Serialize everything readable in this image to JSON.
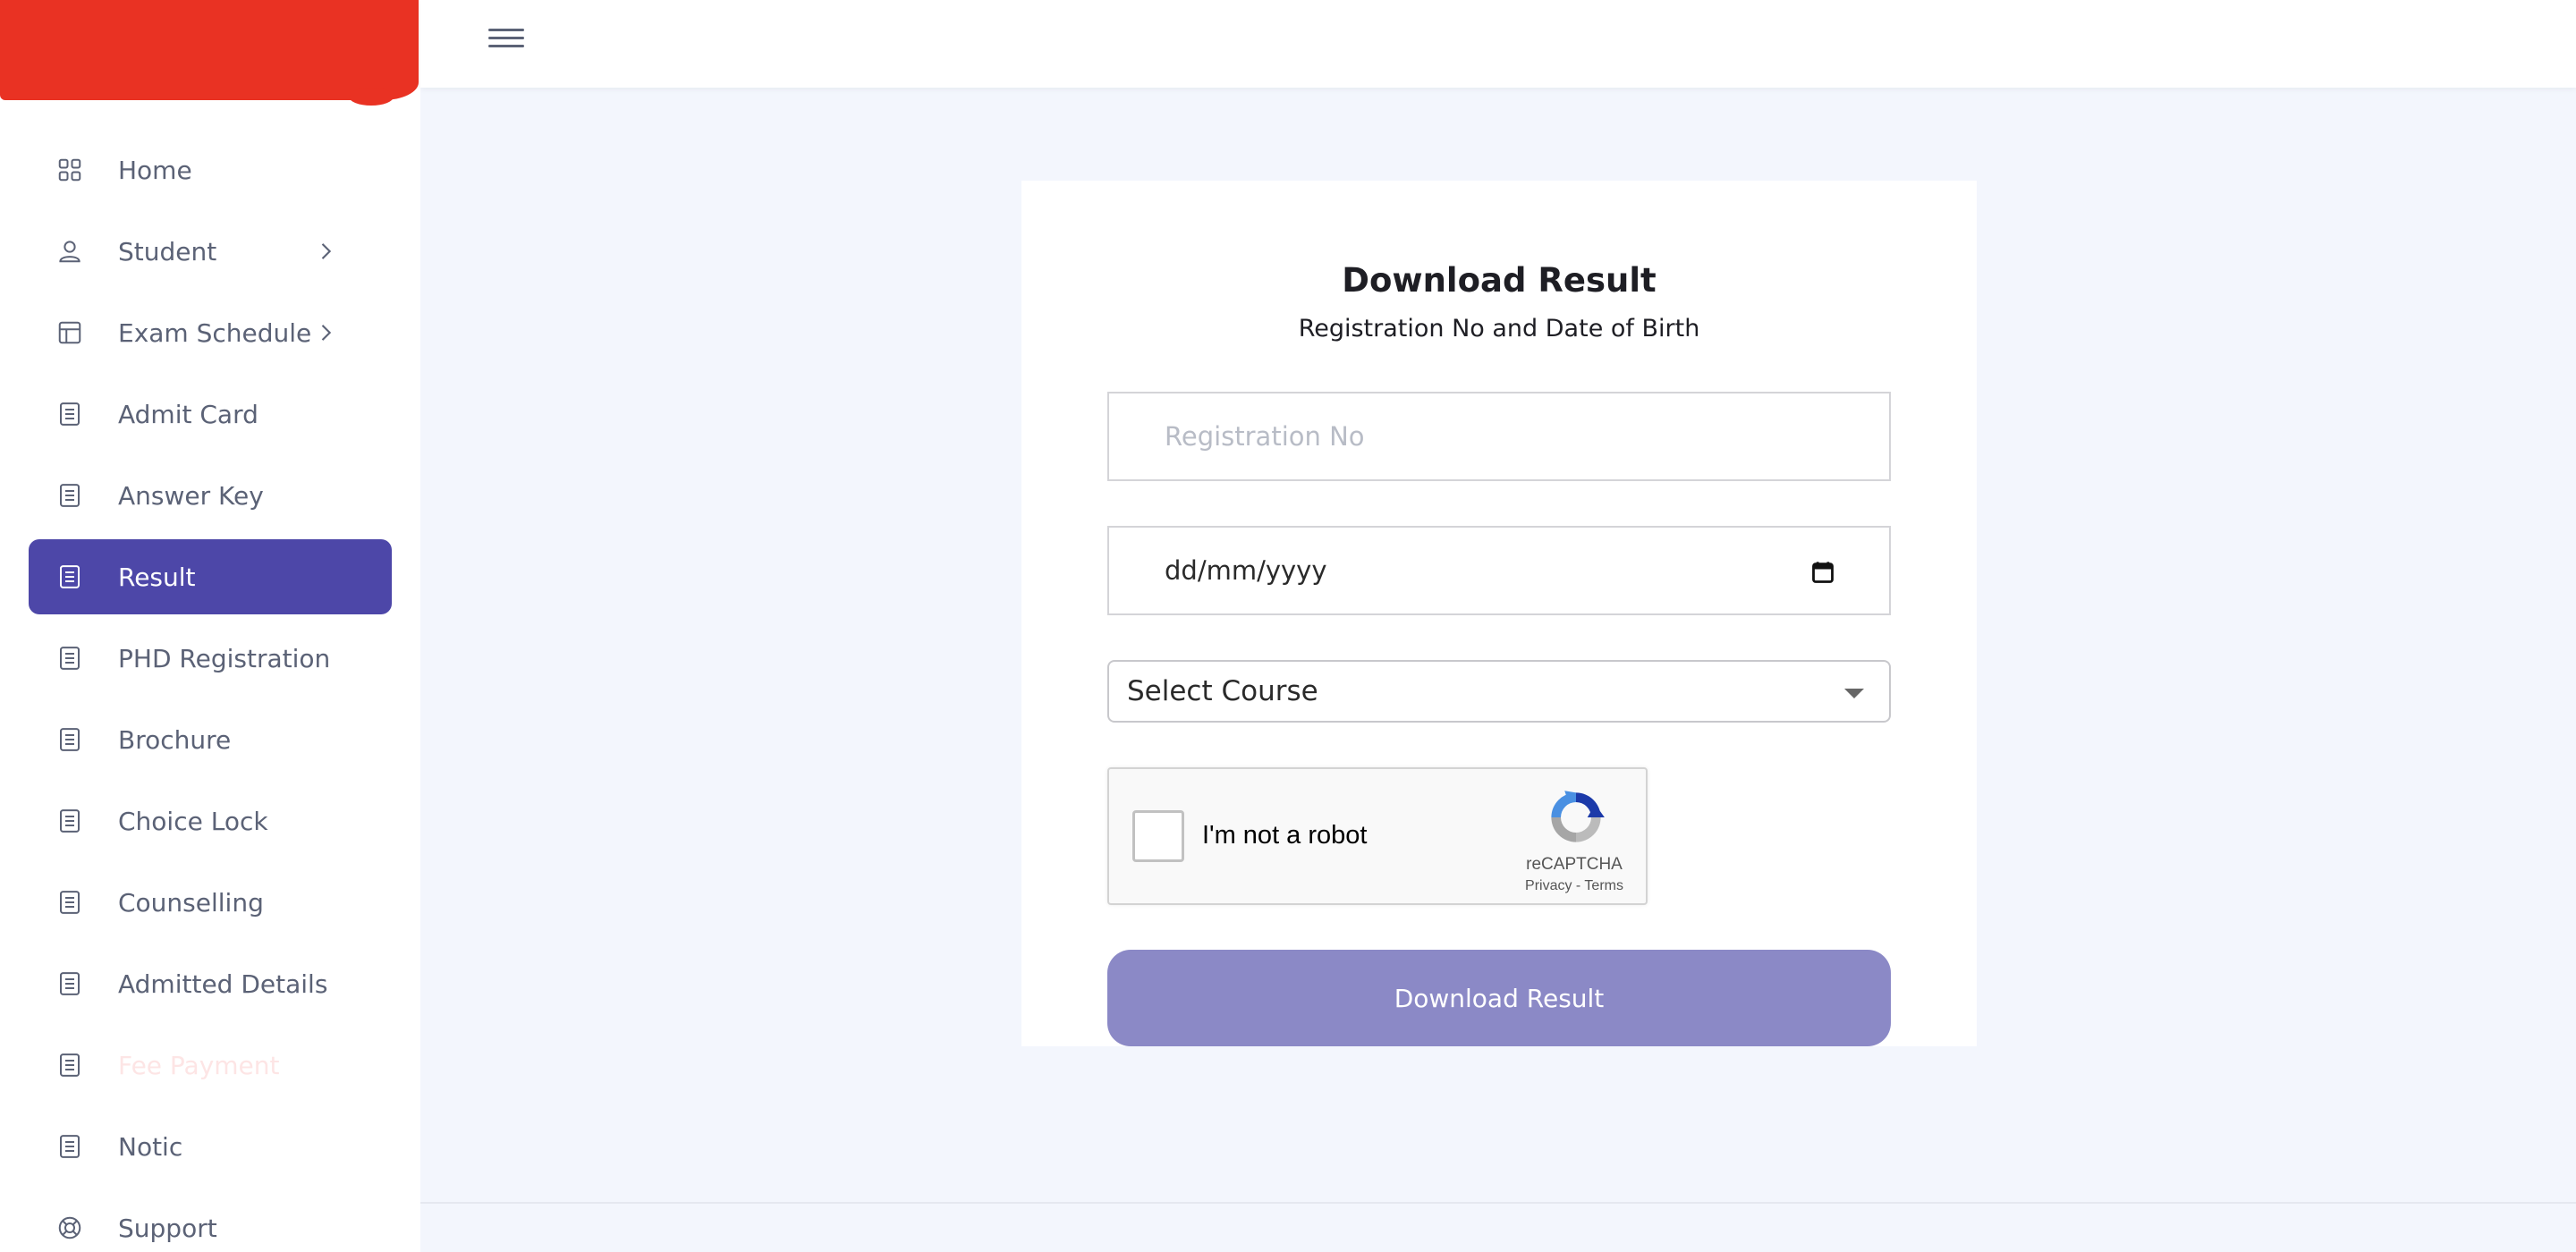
{
  "topbar": {
    "menu_icon": "hamburger-menu-icon"
  },
  "sidebar": {
    "active_color": "#4d47a8",
    "items": [
      {
        "label": "Home",
        "icon": "grid-icon",
        "has_submenu": false
      },
      {
        "label": "Student",
        "icon": "user-icon",
        "has_submenu": true
      },
      {
        "label": "Exam Schedule",
        "icon": "layout-icon",
        "has_submenu": true
      },
      {
        "label": "Admit Card",
        "icon": "document-icon",
        "has_submenu": false
      },
      {
        "label": "Answer Key",
        "icon": "document-icon",
        "has_submenu": false
      },
      {
        "label": "Result",
        "icon": "document-icon",
        "has_submenu": false,
        "active": true
      },
      {
        "label": "PHD Registration",
        "icon": "document-icon",
        "has_submenu": false
      },
      {
        "label": "Brochure",
        "icon": "document-icon",
        "has_submenu": false
      },
      {
        "label": "Choice Lock",
        "icon": "document-icon",
        "has_submenu": false
      },
      {
        "label": "Counselling",
        "icon": "document-icon",
        "has_submenu": false
      },
      {
        "label": "Admitted Details",
        "icon": "document-icon",
        "has_submenu": false
      },
      {
        "label": "Fee Payment",
        "icon": "document-icon",
        "has_submenu": false
      },
      {
        "label": "Notic",
        "icon": "document-icon",
        "has_submenu": false
      },
      {
        "label": "Support",
        "icon": "lifebuoy-icon",
        "has_submenu": false
      }
    ]
  },
  "form": {
    "title": "Download Result",
    "subtitle": "Registration No and Date of Birth",
    "registration_placeholder": "Registration No",
    "dob_placeholder": "dd/mm/yyyy",
    "course_select": "Select Course",
    "captcha": {
      "label": "I'm not a robot",
      "brand": "reCAPTCHA",
      "links": "Privacy - Terms"
    },
    "submit_label": "Download Result",
    "submit_color": "#8b89c6"
  }
}
